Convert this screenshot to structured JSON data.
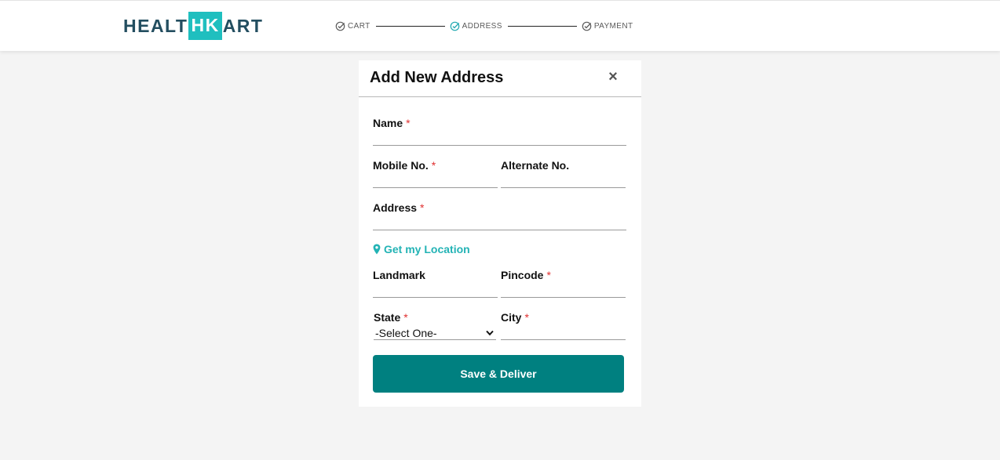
{
  "brand": {
    "logo_part1": "HEALT",
    "logo_part2": "HK",
    "logo_part3": "ART",
    "colors": {
      "primary": "#234e60",
      "accent": "#1fbfbf",
      "button": "#008080"
    }
  },
  "steps": [
    {
      "label": "CART",
      "icon": "check-circle-icon",
      "active": false
    },
    {
      "label": "ADDRESS",
      "icon": "check-circle-icon",
      "active": true
    },
    {
      "label": "PAYMENT",
      "icon": "check-circle-icon",
      "active": false
    }
  ],
  "modal": {
    "title": "Add New Address",
    "close_symbol": "×",
    "fields": {
      "name": {
        "label": "Name",
        "required": "*",
        "value": ""
      },
      "mobile": {
        "label": "Mobile No.",
        "required": "*",
        "value": ""
      },
      "alternate": {
        "label": "Alternate No.",
        "value": ""
      },
      "address": {
        "label": "Address",
        "required": "*",
        "value": ""
      },
      "landmark": {
        "label": "Landmark",
        "value": ""
      },
      "pincode": {
        "label": "Pincode",
        "required": "*",
        "value": ""
      },
      "state": {
        "label": "State",
        "required": "*",
        "selected": "-Select One-"
      },
      "city": {
        "label": "City",
        "required": "*",
        "value": ""
      }
    },
    "location_link": "Get my Location",
    "save_button": "Save & Deliver"
  }
}
